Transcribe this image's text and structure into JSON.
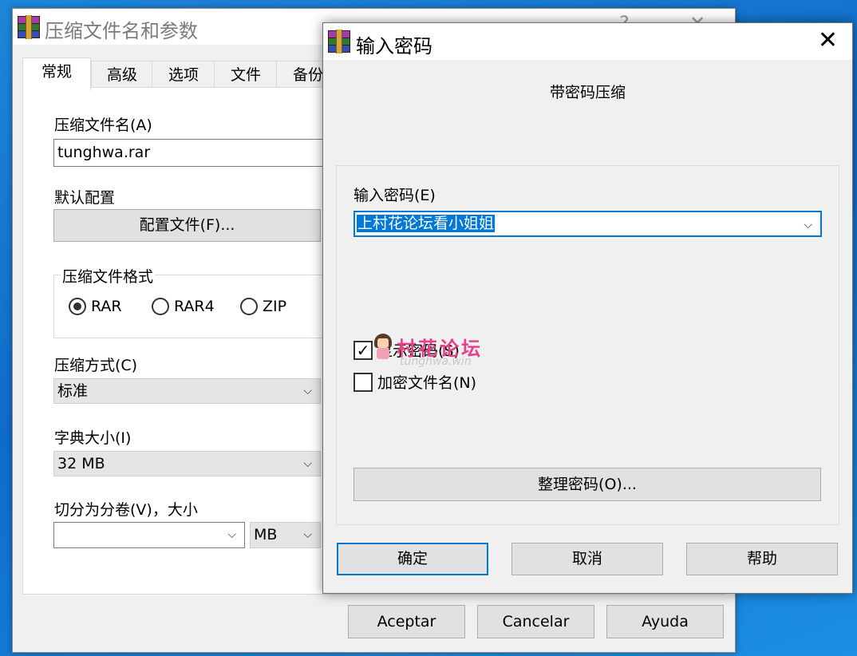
{
  "back_window": {
    "title": "压缩文件名和参数",
    "help_symbol": "?",
    "close_symbol": "✕",
    "tabs": [
      "常规",
      "高级",
      "选项",
      "文件",
      "备份"
    ],
    "archive_name_label": "压缩文件名(A)",
    "archive_name_value": "tunghwa.rar",
    "default_profile_label": "默认配置",
    "profile_button": "配置文件(F)...",
    "format_group_label": "压缩文件格式",
    "formats": [
      {
        "label": "RAR",
        "selected": true
      },
      {
        "label": "RAR4",
        "selected": false
      },
      {
        "label": "ZIP",
        "selected": false
      }
    ],
    "method_label": "压缩方式(C)",
    "method_value": "标准",
    "dict_label": "字典大小(I)",
    "dict_value": "32 MB",
    "split_label": "切分为分卷(V)，大小",
    "split_value": "",
    "split_unit": "MB",
    "buttons": {
      "ok": "Aceptar",
      "cancel": "Cancelar",
      "help": "Ayuda"
    }
  },
  "dialog": {
    "title": "输入密码",
    "close_symbol": "✕",
    "heading": "带密码压缩",
    "password_label": "输入密码(E)",
    "password_value": "上村花论坛看小姐姐",
    "show_password_label": "显示密码(S)",
    "show_password_checked": true,
    "encrypt_names_label": "加密文件名(N)",
    "encrypt_names_checked": false,
    "organize_button": "整理密码(O)...",
    "buttons": {
      "ok": "确定",
      "cancel": "取消",
      "help": "帮助"
    }
  },
  "watermark": {
    "text": "村花论坛",
    "subtext": "tunghwa.win"
  },
  "colors": {
    "desktop": "#0f6cc9",
    "selection": "#0078d7",
    "focus_border": "#0078d7",
    "watermark": "#e6428a"
  },
  "icons": {
    "app": "winrar-books-icon",
    "dropdown": "chevron-down-icon",
    "check": "checkmark-icon"
  }
}
